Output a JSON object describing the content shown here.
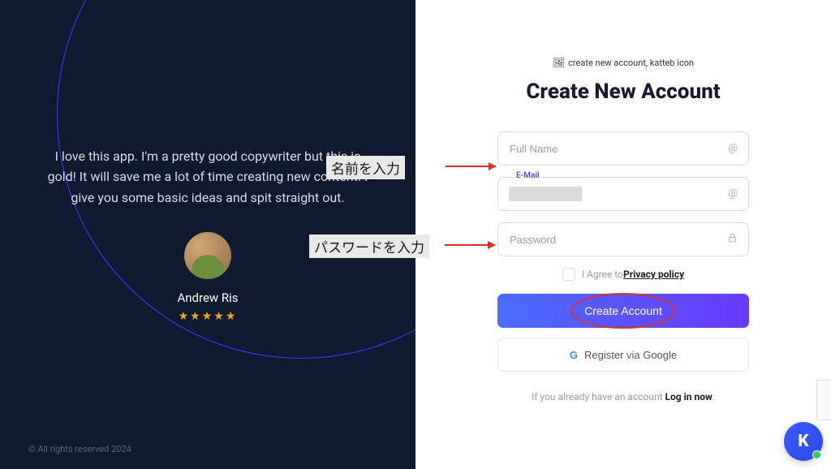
{
  "left": {
    "testimonial": "I love this app. I'm a pretty good copywriter but this is gold! It will save me a lot of time creating new content. I give you some basic ideas and spit straight out.",
    "author": "Andrew Ris",
    "stars": "★★★★★",
    "copyright": "©   All rights reserved 2024"
  },
  "right": {
    "logo_alt": "create new account, katteb icon",
    "title": "Create New Account",
    "fullname_placeholder": "Full Name",
    "email_label": "E-Mail",
    "password_placeholder": "Password",
    "agree_prefix": "I Agree to ",
    "privacy_link": "Privacy policy",
    "create_button": "Create Account",
    "google_button": "Register via Google",
    "login_prompt_prefix": "If you already have an account  ",
    "login_link": "Log in now",
    "login_suffix": "."
  },
  "annotations": {
    "name_label": "名前を入力",
    "password_label": "パスワードを入力"
  },
  "chat": {
    "letter": "K"
  }
}
